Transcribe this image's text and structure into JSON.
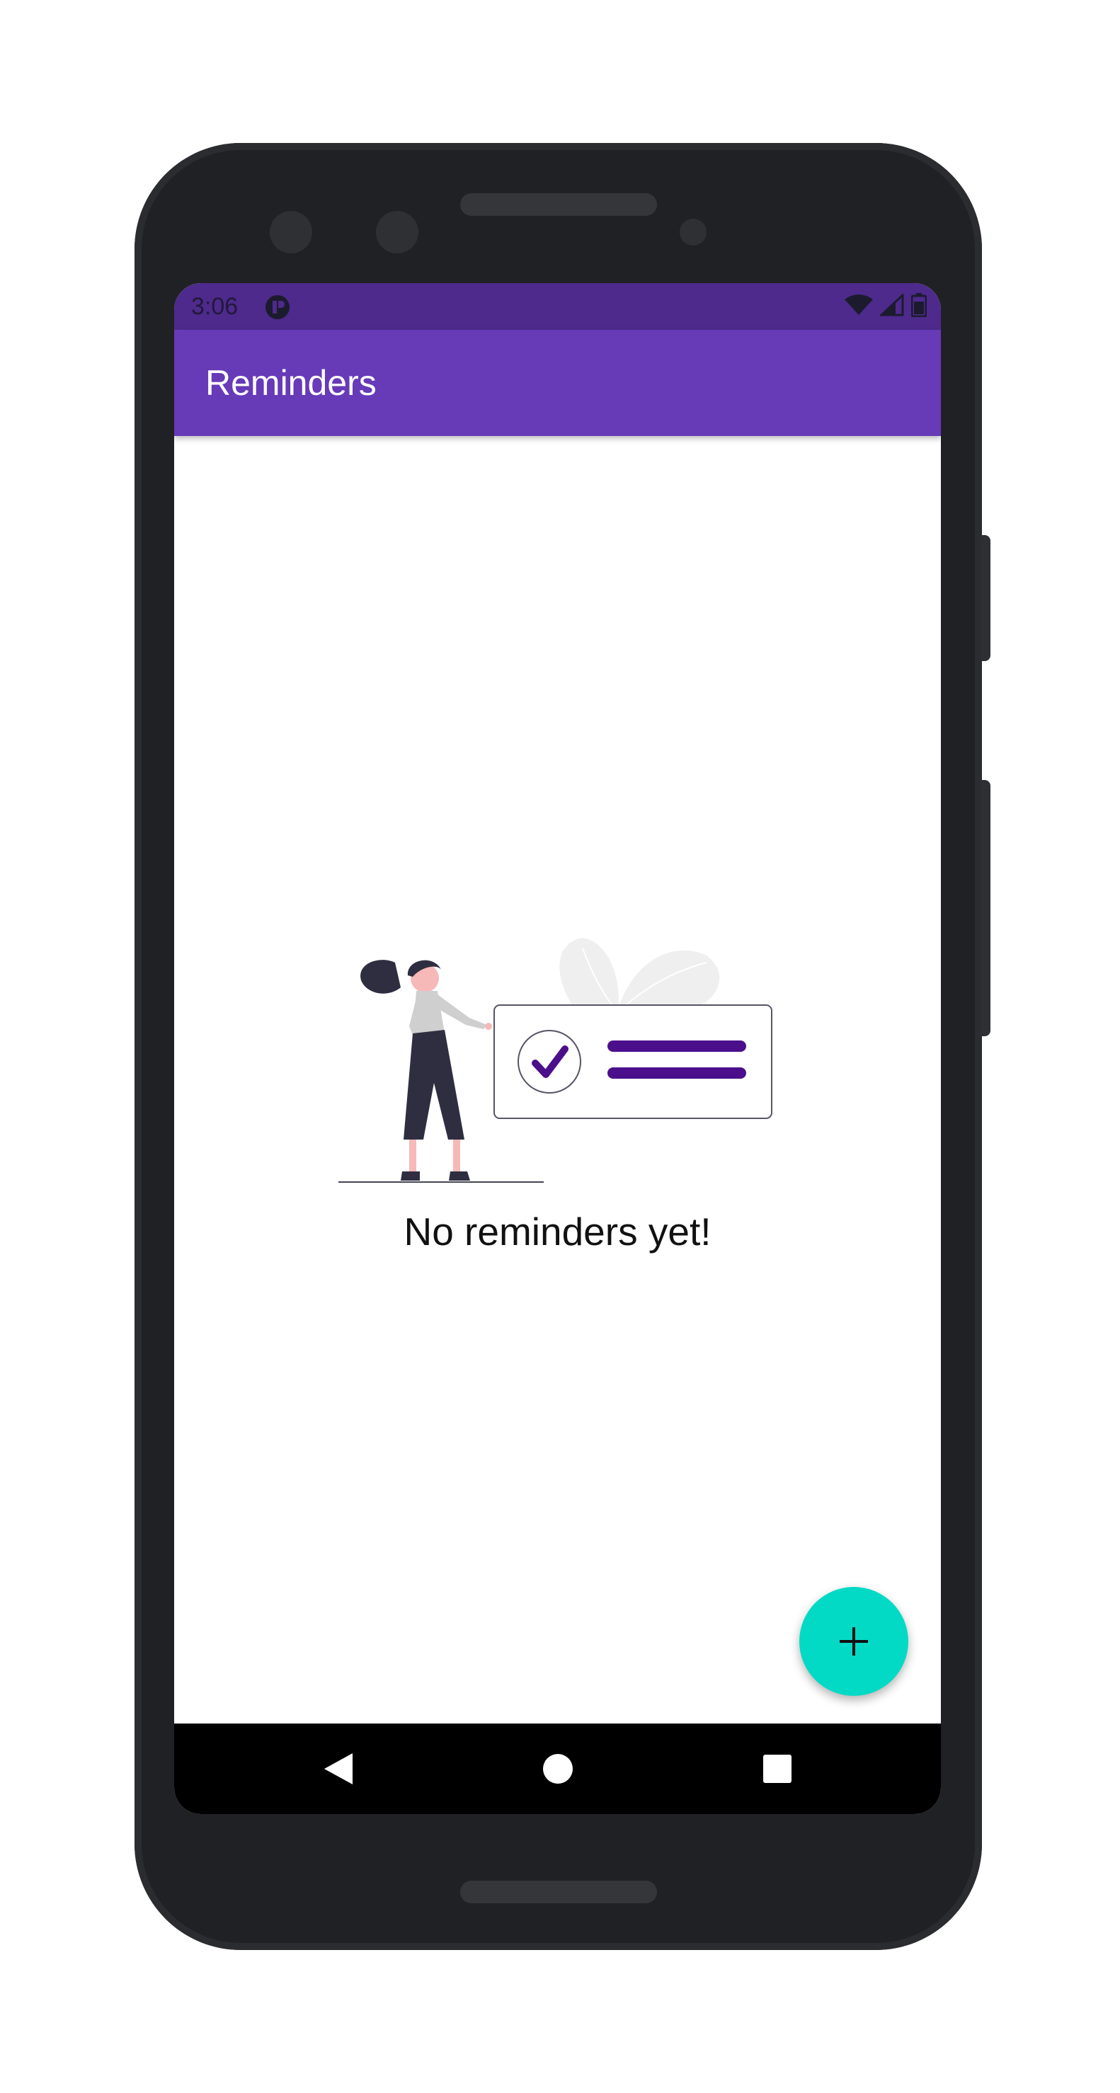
{
  "status_bar": {
    "time": "3:06",
    "icons": [
      "app-notification-icon",
      "wifi-icon",
      "signal-icon",
      "battery-icon"
    ]
  },
  "app_bar": {
    "title": "Reminders"
  },
  "empty_state": {
    "message": "No reminders yet!"
  },
  "fab": {
    "icon": "plus-icon"
  },
  "nav_bar": {
    "buttons": [
      "back-icon",
      "home-icon",
      "recents-icon"
    ]
  },
  "colors": {
    "primary": "#673ab7",
    "primary_dark": "#4e2a8c",
    "accent": "#03dac5",
    "illustration_purple": "#4b0f8c"
  }
}
